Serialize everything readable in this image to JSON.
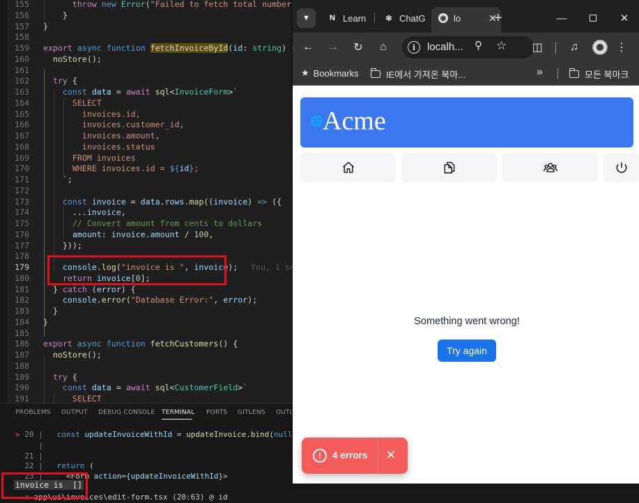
{
  "editor": {
    "lines": [
      {
        "n": "155",
        "html": "      <span class='kw2'>throw</span> <span class='kw'>new</span> <span class='typ'>Error</span>(<span class='str'>\"Failed to fetch total number of invoices.\"</span>);"
      },
      {
        "n": "156",
        "html": "    }"
      },
      {
        "n": "157",
        "html": "}"
      },
      {
        "n": "158",
        "html": ""
      },
      {
        "n": "159",
        "html": "<span class='kw2'>export</span> <span class='kw'>async</span> <span class='kw'>function</span> <span class='hl'>fetchInvoiceById</span>(<span class='var'>id</span>: <span class='typ'>string</span>) {"
      },
      {
        "n": "160",
        "html": "  <span class='fn'>noStore</span>();"
      },
      {
        "n": "161",
        "html": ""
      },
      {
        "n": "162",
        "html": "  <span class='kw2'>try</span> {"
      },
      {
        "n": "163",
        "html": "    <span class='kw'>const</span> <span class='var'>data</span> = <span class='kw2'>await</span> <span class='fn'>sql</span>&lt;<span class='typ'>InvoiceForm</span>&gt;<span class='str'>`</span>"
      },
      {
        "n": "164",
        "html": "<span class='str'>      SELECT</span>"
      },
      {
        "n": "165",
        "html": "<span class='str'>        invoices.id,</span>"
      },
      {
        "n": "166",
        "html": "<span class='str'>        invoices.customer_id,</span>"
      },
      {
        "n": "167",
        "html": "<span class='str'>        invoices.amount,</span>"
      },
      {
        "n": "168",
        "html": "<span class='str'>        invoices.status</span>"
      },
      {
        "n": "169",
        "html": "<span class='str'>      FROM invoices</span>"
      },
      {
        "n": "170",
        "html": "<span class='str'>      WHERE invoices.id = </span><span class='kw'>${</span><span class='var'>id</span><span class='kw'>}</span><span class='str'>;</span>"
      },
      {
        "n": "171",
        "html": "<span class='str'>    `</span>;"
      },
      {
        "n": "172",
        "html": ""
      },
      {
        "n": "173",
        "html": "    <span class='kw'>const</span> <span class='var'>invoice</span> = <span class='var'>data</span>.<span class='var'>rows</span>.<span class='fn'>map</span>((<span class='var'>invoice</span>) <span class='kw'>=&gt;</span> ({"
      },
      {
        "n": "174",
        "html": "      ...<span class='var'>invoice</span>,"
      },
      {
        "n": "175",
        "html": "      <span class='cm'>// Convert amount from cents to dollars</span>"
      },
      {
        "n": "176",
        "html": "      <span class='var'>amount</span>: <span class='var'>invoice</span>.<span class='var'>amount</span> / <span class='num'>100</span>,"
      },
      {
        "n": "177",
        "html": "    }));"
      },
      {
        "n": "178",
        "html": ""
      },
      {
        "n": "179",
        "html": "    <span class='var'>console</span>.<span class='fn'>log</span>(<span class='str'>\"invoice is \"</span>, <span class='var'>invoice</span>);"
      },
      {
        "n": "180",
        "html": "    <span class='kw2'>return</span> <span class='var'>invoice</span>[<span class='num'>0</span>];"
      },
      {
        "n": "181",
        "html": "  } <span class='kw2'>catch</span> (<span class='var'>error</span>) {"
      },
      {
        "n": "182",
        "html": "    <span class='var'>console</span>.<span class='fn'>error</span>(<span class='str'>\"Database Error:\"</span>, <span class='var'>error</span>);"
      },
      {
        "n": "183",
        "html": "  }"
      },
      {
        "n": "184",
        "html": "}"
      },
      {
        "n": "185",
        "html": ""
      },
      {
        "n": "186",
        "html": "<span class='kw2'>export</span> <span class='kw'>async</span> <span class='kw'>function</span> <span class='fn'>fetchCustomers</span>() {"
      },
      {
        "n": "187",
        "html": "  <span class='fn'>noStore</span>();"
      },
      {
        "n": "188",
        "html": ""
      },
      {
        "n": "189",
        "html": "  <span class='kw2'>try</span> {"
      },
      {
        "n": "190",
        "html": "    <span class='kw'>const</span> <span class='var'>data</span> = <span class='kw2'>await</span> <span class='fn'>sql</span>&lt;<span class='typ'>CustomerField</span>&gt;<span class='str'>`</span>"
      },
      {
        "n": "191",
        "html": "<span class='str'>      SELECT</span>"
      }
    ],
    "active_line": "179",
    "blame": "You, 1 se"
  },
  "panel": {
    "tabs": [
      "PROBLEMS",
      "OUTPUT",
      "DEBUG CONSOLE",
      "TERMINAL",
      "PORTS",
      "GITLENS",
      "OUTL"
    ],
    "active_tab": "TERMINAL",
    "terminal_lines": [
      {
        "html": "<span class='arrow'>&gt;</span> <span class='lnum'>20</span> <span class='dim'>|</span>   <span class='kw'>const</span> <span class='var'>updateInvoiceWithId</span> = <span class='fn'>updateInvoice</span>.<span class='fn'>bind</span>(<span class='kw'>null</span>, <span class='var'>invo</span>"
      },
      {
        "html": "     <span class='dim'>|</span>"
      },
      {
        "html": "  <span class='lnum'>21</span> <span class='dim'>|</span>"
      },
      {
        "html": "  <span class='lnum'>22</span> <span class='dim'>|</span>   <span class='kw'>return</span> ("
      },
      {
        "html": "  <span class='lnum'>23</span> <span class='dim'>|</span>     &lt;<span class='typ'>Form</span> <span class='var'>action</span>={<span class='var'>updateInvoiceWithId</span>}&gt;"
      },
      {
        "html": ""
      },
      {
        "html": "  <span class='dim'>x</span> app\\ui\\invoices\\edit-form.tsx (20:63) @ id"
      }
    ],
    "log_output": "invoice is  []"
  },
  "browser": {
    "tabs": [
      {
        "label": "Learn",
        "favicon": "N"
      },
      {
        "label": "ChatG",
        "favicon": "chatgpt"
      },
      {
        "label": "lo",
        "favicon": "globe"
      }
    ],
    "new_tab": "+",
    "url": "localh...",
    "bookmarks": {
      "star_label": "Bookmarks",
      "folder1": "IE에서 가져온 북마...",
      "overflow": "»",
      "folder2": "모든 북마크"
    }
  },
  "app": {
    "brand": "Acme",
    "nav": [
      "home",
      "documents",
      "customers",
      "power"
    ],
    "error_message": "Something went wrong!",
    "try_again": "Try again"
  },
  "toast": {
    "label": "4 errors"
  },
  "colors": {
    "accent": "#3b78f0",
    "button": "#1a73e8",
    "toast": "#f45b5b",
    "annotation": "#e3101c"
  }
}
